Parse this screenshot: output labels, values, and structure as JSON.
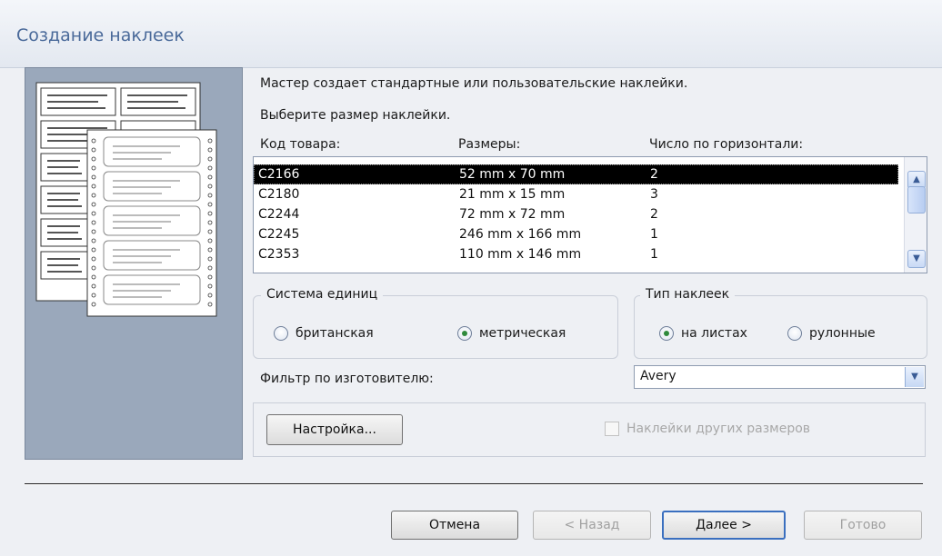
{
  "window": {
    "title": "Создание наклеек"
  },
  "intro": {
    "line1": "Мастер создает стандартные или пользовательские наклейки.",
    "line2": "Выберите размер наклейки."
  },
  "list": {
    "headers": {
      "code": "Код товара:",
      "size": "Размеры:",
      "across": "Число по горизонтали:"
    },
    "rows": [
      {
        "code": "C2166",
        "size": "52 mm x 70 mm",
        "across": "2",
        "selected": true
      },
      {
        "code": "C2180",
        "size": "21 mm x 15 mm",
        "across": "3"
      },
      {
        "code": "C2244",
        "size": "72 mm x 72 mm",
        "across": "2"
      },
      {
        "code": "C2245",
        "size": "246 mm x 166 mm",
        "across": "1"
      },
      {
        "code": "C2353",
        "size": "110 mm x 146 mm",
        "across": "1"
      }
    ]
  },
  "units": {
    "title": "Система единиц",
    "imperial": "британская",
    "metric": "метрическая",
    "selected": "metric"
  },
  "label_type": {
    "title": "Тип наклеек",
    "sheet": "на листах",
    "roll": "рулонные",
    "selected": "sheet"
  },
  "filter": {
    "label": "Фильтр по изготовителю:",
    "value": "Avery"
  },
  "customize_button": "Настройка...",
  "custom_sizes_checkbox": "Наклейки других размеров",
  "footer": {
    "cancel": "Отмена",
    "back": "< Назад",
    "next": "Далее >",
    "finish": "Готово"
  },
  "icons": [
    "label-sheet-illustration-icon",
    "scroll-up-icon",
    "scroll-down-icon",
    "dropdown-arrow-icon"
  ],
  "colors": {
    "title_text": "#4a6a9a",
    "selection_bg": "#000000",
    "illustration_bg": "#9aa8bb"
  }
}
